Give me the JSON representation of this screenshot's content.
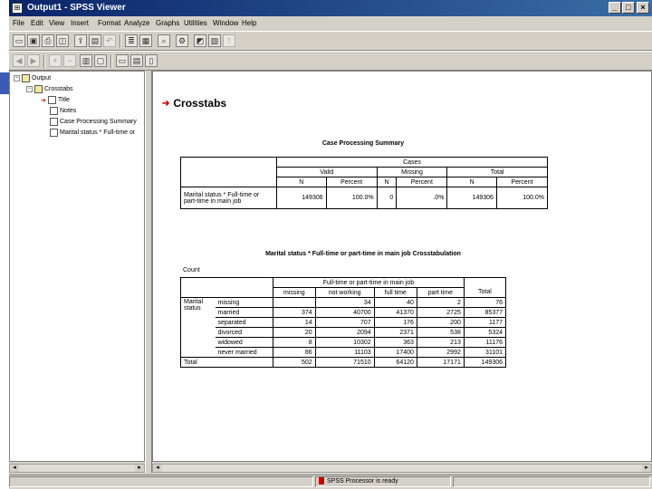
{
  "window": {
    "title": "Output1 - SPSS Viewer",
    "icon": "spss-icon"
  },
  "menu": [
    "File",
    "Edit",
    "View",
    "Insert",
    "Format",
    "Analyze",
    "Graphs",
    "Utilities",
    "Window",
    "Help"
  ],
  "outline": {
    "items": [
      {
        "label": "Output",
        "icon": "folder-icon"
      },
      {
        "label": "Crosstabs",
        "icon": "book-icon"
      },
      {
        "label": "Title",
        "icon": "title-icon"
      },
      {
        "label": "Notes",
        "icon": "notes-icon"
      },
      {
        "label": "Case Processing Summary",
        "icon": "table-icon"
      },
      {
        "label": "Marital status * Full-time or",
        "icon": "table-icon"
      }
    ]
  },
  "content": {
    "heading": "Crosstabs",
    "summary": {
      "title": "Case Processing Summary",
      "cases_header": "Cases",
      "groups": [
        "Valid",
        "Missing",
        "Total"
      ],
      "subheads": [
        "N",
        "Percent",
        "N",
        "Percent",
        "N",
        "Percent"
      ],
      "row_label": "Marital status * Full-time or part-time in main job",
      "row_values": [
        "149306",
        "100.0%",
        "0",
        ".0%",
        "149306",
        "100.0%"
      ]
    },
    "crosstab": {
      "title": "Marital status * Full-time or part-time in main job Crosstabulation",
      "count_label": "Count",
      "col_group": "Full-time or part-time in main job",
      "columns": [
        "missing",
        "not working",
        "full time",
        "part time",
        "Total"
      ],
      "row_group": "Marital status",
      "total_label": "Total",
      "rows": [
        {
          "label": "missing",
          "values": [
            "",
            "34",
            "40",
            "2",
            "76"
          ]
        },
        {
          "label": "married",
          "values": [
            "374",
            "40700",
            "41370",
            "2725",
            "85377"
          ]
        },
        {
          "label": "separated",
          "values": [
            "14",
            "707",
            "176",
            "200",
            "1177"
          ]
        },
        {
          "label": "divorced",
          "values": [
            "20",
            "2094",
            "2371",
            "538",
            "5324"
          ]
        },
        {
          "label": "widowed",
          "values": [
            "8",
            "10302",
            "363",
            "213",
            "11176"
          ]
        },
        {
          "label": "never married",
          "values": [
            "86",
            "11103",
            "17400",
            "2992",
            "31101"
          ]
        }
      ],
      "total_values": [
        "502",
        "71510",
        "64120",
        "17171",
        "149306"
      ]
    }
  },
  "status": {
    "message": "SPSS Processor  is ready"
  }
}
